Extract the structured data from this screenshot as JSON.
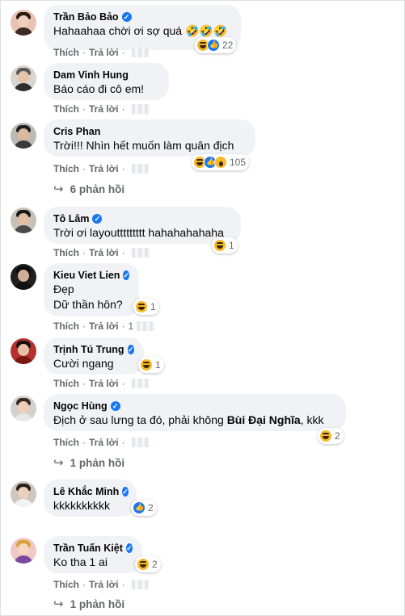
{
  "actions": {
    "like": "Thích",
    "reply": "Trả lời",
    "separator": "·"
  },
  "colors": {
    "bubble": "#f0f2f5",
    "verified": "#1877f2",
    "meta": "#65676b"
  },
  "comments": [
    {
      "name": "Trần Bảo Bảo",
      "verified": true,
      "text": "Hahaahaa chời ơi sợ quá 🤣🤣🤣",
      "reactions": [
        "haha",
        "like"
      ],
      "reaction_count": "22",
      "time": ""
    },
    {
      "name": "Dam Vinh Hung",
      "verified": false,
      "text": "Báo cáo đi cô em!",
      "reactions": [],
      "reaction_count": "",
      "time": ""
    },
    {
      "name": "Cris Phan",
      "verified": false,
      "text": "Trời!!! Nhìn hết muốn làm quân địch",
      "reactions": [
        "haha",
        "like",
        "wow"
      ],
      "reaction_count": "105",
      "time": "",
      "replies": "6 phản hồi"
    },
    {
      "name": "Tô Lâm",
      "verified": true,
      "text": "Trời ơi layouttttttttt hahahahahaha",
      "reactions": [
        "haha"
      ],
      "reaction_count": "1",
      "time": ""
    },
    {
      "name": "Kieu Viet Lien",
      "verified": true,
      "text_lines": [
        "Đẹp",
        "Dữ thần hôn?"
      ],
      "reactions": [
        "haha"
      ],
      "reaction_count": "1",
      "time": "1"
    },
    {
      "name": "Trịnh Tú Trung",
      "verified": true,
      "text": "Cười ngang",
      "reactions": [
        "haha"
      ],
      "reaction_count": "1",
      "time": ""
    },
    {
      "name": "Ngọc Hùng",
      "verified": true,
      "text_before": "Địch ở sau lưng ta đó, phải không ",
      "text_mention": "Bùi Đại Nghĩa",
      "text_after": ", kkk",
      "reactions": [
        "haha"
      ],
      "reaction_count": "2",
      "time": "",
      "replies": "1 phản hồi"
    },
    {
      "name": "Lê Khắc Minh",
      "verified": true,
      "text": "kkkkkkkkkk",
      "reactions": [
        "like"
      ],
      "reaction_count": "2",
      "time": ""
    },
    {
      "name": "Trần Tuấn Kiệt",
      "verified": true,
      "text": "Ko tha 1 ai",
      "reactions": [
        "haha"
      ],
      "reaction_count": "2",
      "time": "",
      "replies": "1 phản hồi"
    }
  ]
}
